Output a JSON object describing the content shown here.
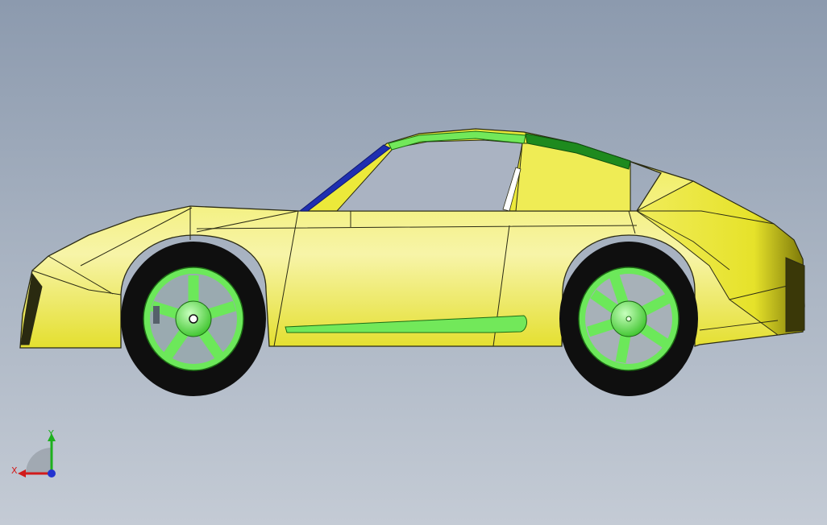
{
  "viewport": {
    "background_top": "#8c9aae",
    "background_bottom": "#c4cbd5"
  },
  "model": {
    "colors": {
      "body": "#ece93a",
      "body_light": "#f5f39c",
      "body_shadow": "#c7c21a",
      "windshield_pillar": "#1f2fb0",
      "glass_trim": "#72e85a",
      "roof_dark": "#1e8a1e",
      "wheel": "#6ce85a",
      "tire": "#0f0f0f",
      "edge": "#2b2b14"
    }
  },
  "triad": {
    "x_label": "X",
    "y_label": "Y",
    "x_color": "#d11b1b",
    "y_color": "#1db01d",
    "z_color": "#2233d0"
  }
}
